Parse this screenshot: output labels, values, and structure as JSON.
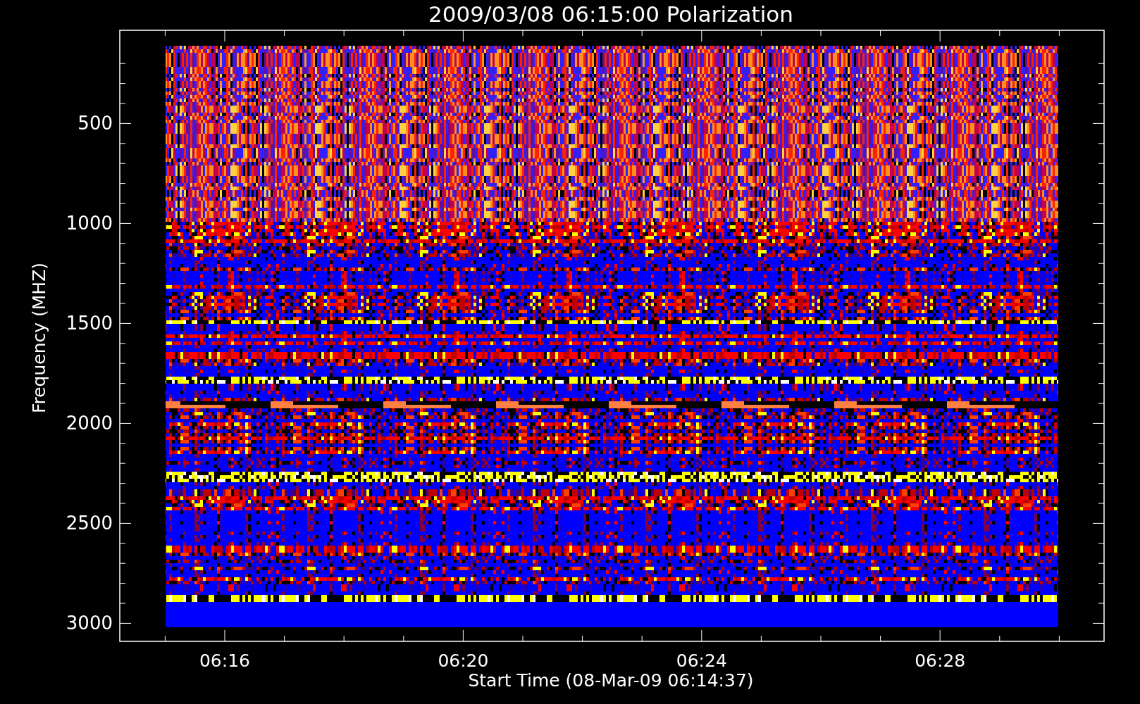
{
  "title": "2009/03/08 06:15:00 Polarization",
  "y_axis": {
    "label": "Frequency (MHZ)",
    "ticks": [
      "500",
      "1000",
      "1500",
      "2000",
      "2500",
      "3000"
    ]
  },
  "x_axis": {
    "label": "Start Time (08-Mar-09 06:14:37)",
    "ticks": [
      "06:16",
      "06:20",
      "06:24",
      "06:28"
    ]
  }
}
